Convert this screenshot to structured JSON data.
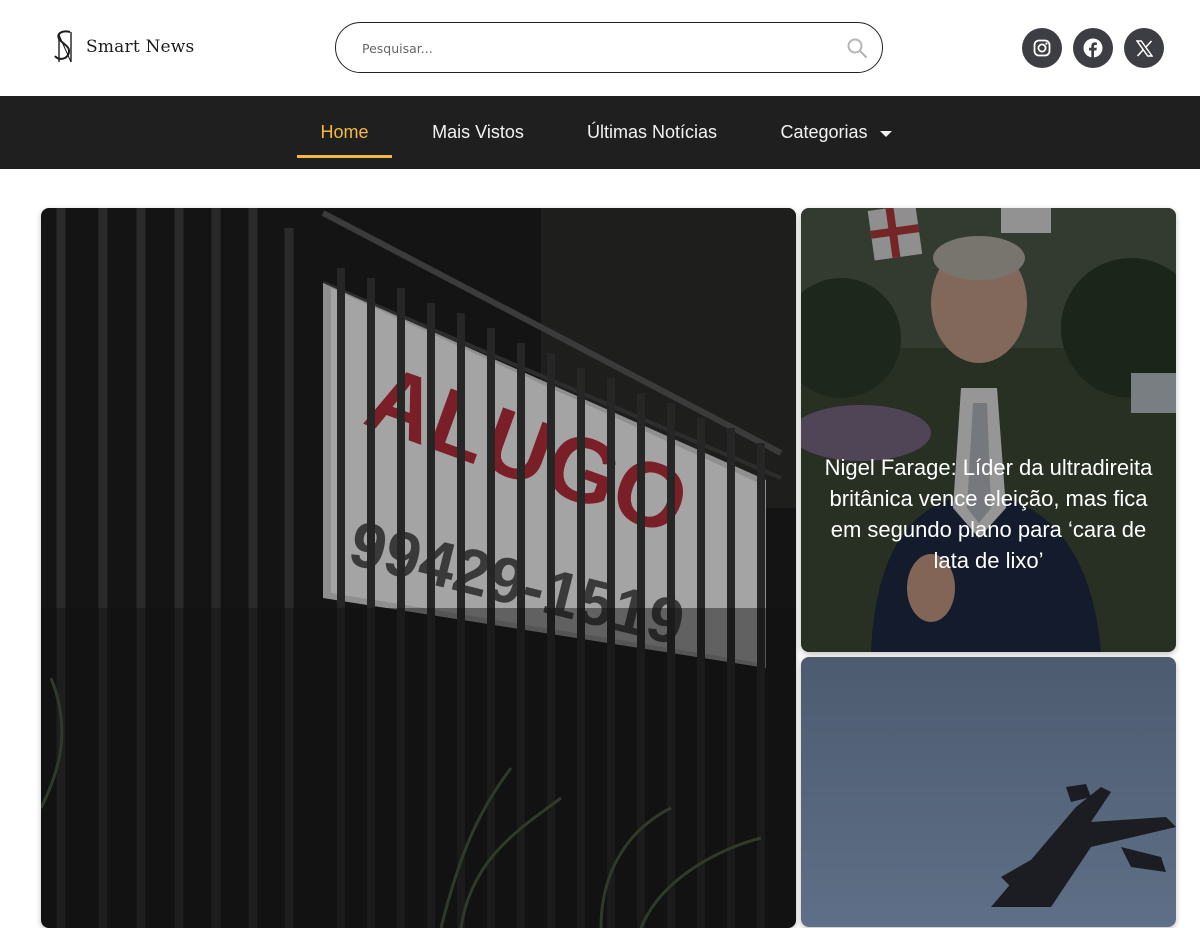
{
  "header": {
    "logo_text": "Smart News",
    "logo_monogram": "SN",
    "search_placeholder": "Pesquisar...",
    "socials": [
      {
        "icon": "instagram-icon"
      },
      {
        "icon": "facebook-icon"
      },
      {
        "icon": "x-icon"
      }
    ]
  },
  "nav": {
    "items": [
      {
        "label": "Home",
        "active": true
      },
      {
        "label": "Mais Vistos"
      },
      {
        "label": "Últimas Notícias"
      },
      {
        "label": "Categorias",
        "has_dropdown": true
      }
    ]
  },
  "articles": {
    "main": {
      "image_text_line1": "ALUGO",
      "image_text_line2": "99429-1519"
    },
    "side_top": {
      "title": "Nigel Farage: Líder da ultradireita britânica vence eleição, mas fica em segundo plano para ‘cara de lata de lixo’"
    },
    "side_bottom": {
      "title": ""
    }
  },
  "colors": {
    "accent": "#f5b942",
    "nav_bg": "#1f1f1f",
    "social_bg": "#3d3d44",
    "text_light": "#f2f2f2"
  }
}
